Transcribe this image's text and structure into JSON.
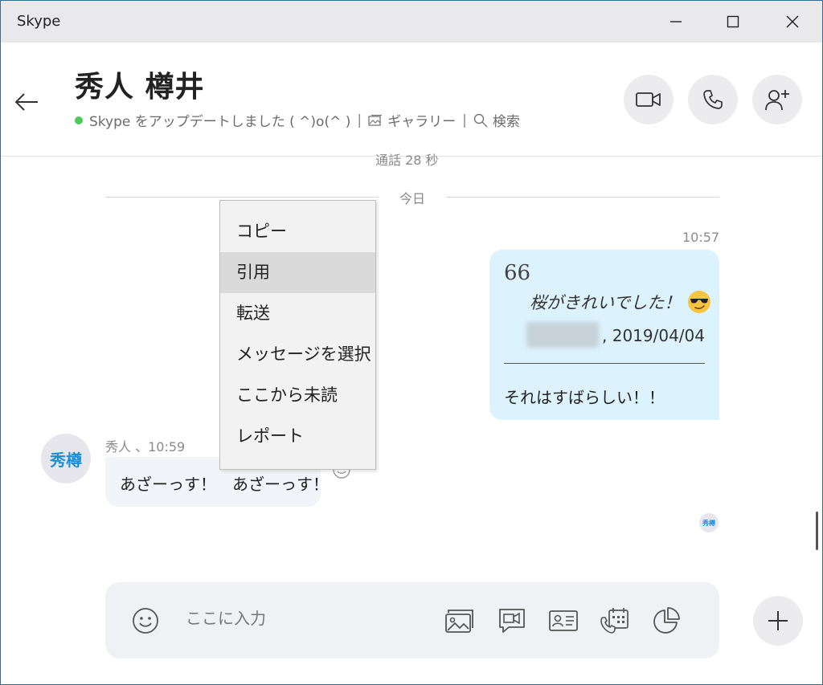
{
  "window": {
    "title": "Skype"
  },
  "header": {
    "contact_name": "秀人 樽井",
    "status_text": "Skype をアップデートしました ( ^)o(^ )",
    "separator": "|",
    "gallery_label": "ギャラリー",
    "search_label": "検索"
  },
  "chat": {
    "previous_text": "通話 28 秒",
    "day_label": "今日",
    "outgoing": {
      "time": "10:57",
      "quote_mark": "66",
      "quote_text": "桜がきれいでした！",
      "quote_date": ", 2019/04/04",
      "reply": "それはすばらしい！！"
    },
    "incoming": {
      "avatar_initials": "秀樽",
      "sender_meta": "秀人 、10:59",
      "text": "あざーっす！　あざーっす！"
    },
    "read_receipt_initials": "秀樽"
  },
  "context_menu": {
    "items": [
      {
        "label": "コピー"
      },
      {
        "label": "引用"
      },
      {
        "label": "転送"
      },
      {
        "label": "メッセージを選択"
      },
      {
        "label": "ここから未読"
      },
      {
        "label": "レポート"
      }
    ],
    "highlighted_index": 1
  },
  "composer": {
    "placeholder": "ここに入力"
  },
  "colors": {
    "accent": "#1a8fd6",
    "online": "#4ccb5a",
    "outgoing_bubble": "#dcf2fd",
    "incoming_bubble": "#f1f4f8"
  }
}
